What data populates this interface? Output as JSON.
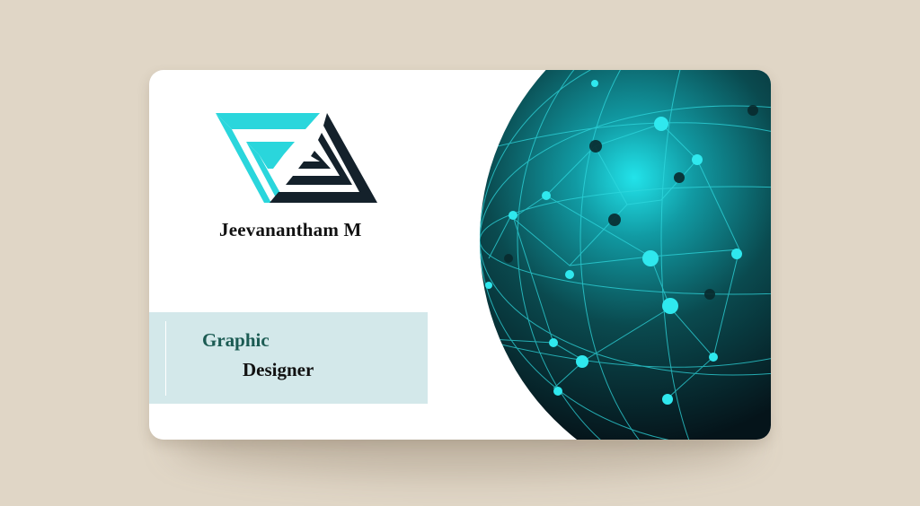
{
  "card": {
    "logo": {
      "icon": "triangle-maze-logo-icon",
      "colors": {
        "cyan": "#2ad6dc",
        "dark": "#14212b"
      }
    },
    "name": "Jeevanantham M",
    "title": {
      "line1": "Graphic",
      "line2": "Designer"
    },
    "globe": {
      "icon": "network-globe-icon",
      "colors": {
        "glow": "#22e3ea",
        "deep": "#071618",
        "nodes": "#2fe8ee"
      }
    }
  },
  "background_color": "#e0d6c6"
}
